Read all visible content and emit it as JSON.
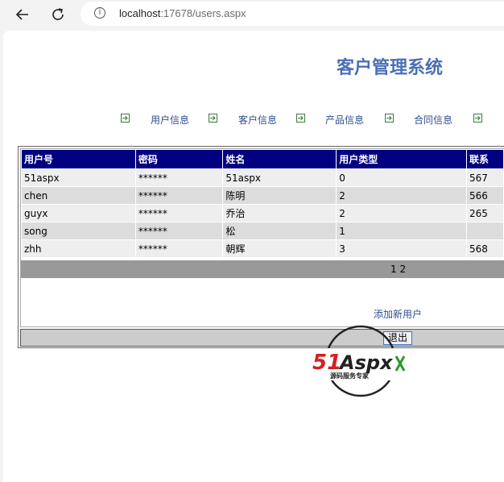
{
  "browser": {
    "url_host": "localhost",
    "url_rest": ":17678/users.aspx"
  },
  "page": {
    "title": "客户管理系统"
  },
  "menu": [
    {
      "label": "用户信息"
    },
    {
      "label": "客户信息"
    },
    {
      "label": "产品信息"
    },
    {
      "label": "合同信息"
    }
  ],
  "table": {
    "headers": [
      "用户号",
      "密码",
      "姓名",
      "用户类型",
      "联系"
    ],
    "rows": [
      [
        "51aspx",
        "******",
        "51aspx",
        "0",
        "567"
      ],
      [
        "chen",
        "******",
        "陈明",
        "2",
        "566"
      ],
      [
        "guyx",
        "******",
        "乔治",
        "2",
        "265"
      ],
      [
        "song",
        "******",
        "松",
        "1",
        ""
      ],
      [
        "zhh",
        "******",
        "朝辉",
        "3",
        "568"
      ]
    ]
  },
  "pager": {
    "text": "1 2"
  },
  "actions": {
    "add_user": "添加新用户",
    "logout": "退出"
  },
  "watermark": {
    "brand": "51Aspx",
    "tagline": "源码服务专家"
  },
  "colors": {
    "header_bg": "#000080",
    "title": "#4a6fb5",
    "link": "#2f4f8f",
    "pager_bg": "#999999"
  }
}
